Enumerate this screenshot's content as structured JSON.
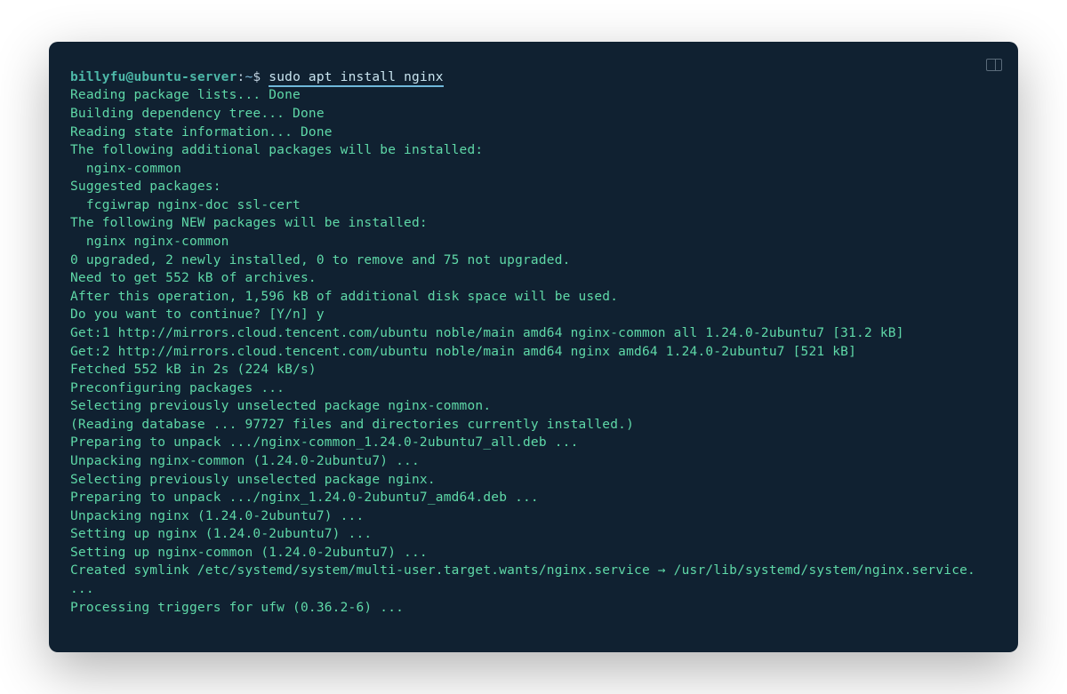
{
  "prompt": {
    "user_host": "billyfu@ubuntu-server",
    "colon": ":",
    "path": "~",
    "dollar": "$",
    "command": "sudo apt install nginx"
  },
  "output_lines": [
    "Reading package lists... Done",
    "Building dependency tree... Done",
    "Reading state information... Done",
    "The following additional packages will be installed:",
    "  nginx-common",
    "Suggested packages:",
    "  fcgiwrap nginx-doc ssl-cert",
    "The following NEW packages will be installed:",
    "  nginx nginx-common",
    "0 upgraded, 2 newly installed, 0 to remove and 75 not upgraded.",
    "Need to get 552 kB of archives.",
    "After this operation, 1,596 kB of additional disk space will be used.",
    "Do you want to continue? [Y/n] y",
    "Get:1 http://mirrors.cloud.tencent.com/ubuntu noble/main amd64 nginx-common all 1.24.0-2ubuntu7 [31.2 kB]",
    "Get:2 http://mirrors.cloud.tencent.com/ubuntu noble/main amd64 nginx amd64 1.24.0-2ubuntu7 [521 kB]",
    "Fetched 552 kB in 2s (224 kB/s)",
    "Preconfiguring packages ...",
    "Selecting previously unselected package nginx-common.",
    "(Reading database ... 97727 files and directories currently installed.)",
    "Preparing to unpack .../nginx-common_1.24.0-2ubuntu7_all.deb ...",
    "Unpacking nginx-common (1.24.0-2ubuntu7) ...",
    "Selecting previously unselected package nginx.",
    "Preparing to unpack .../nginx_1.24.0-2ubuntu7_amd64.deb ...",
    "Unpacking nginx (1.24.0-2ubuntu7) ...",
    "Setting up nginx (1.24.0-2ubuntu7) ...",
    "Setting up nginx-common (1.24.0-2ubuntu7) ...",
    "Created symlink /etc/systemd/system/multi-user.target.wants/nginx.service → /usr/lib/systemd/system/nginx.service.                                     ...",
    "Processing triggers for ufw (0.36.2-6) ..."
  ]
}
